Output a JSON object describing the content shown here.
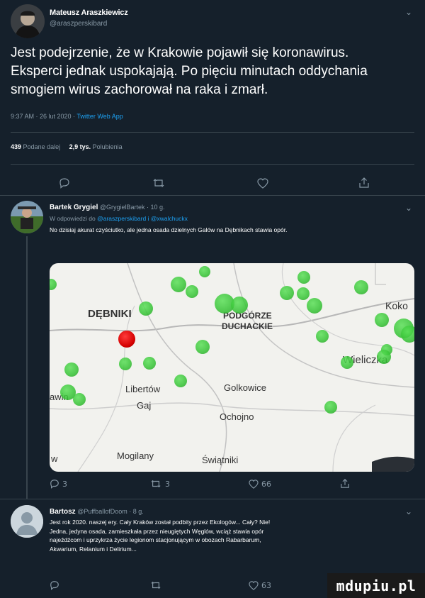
{
  "tweet": {
    "author_name": "Mateusz Araszkiewicz",
    "author_handle": "@araszperskibard",
    "text_lines": [
      "Jest podejrzenie, że w Krakowie pojawił się koronawirus.",
      "Eksperci jednak uspokajają. Po pięciu minutach oddychania",
      "smogiem wirus zachorował na raka i zmarł."
    ],
    "meta_time": "9:37 AM · 26 lut 2020 ·",
    "meta_app": "Twitter Web App",
    "retweets_count": "439",
    "retweets_label": "Podane dalej",
    "likes_count": "2,9 tys.",
    "likes_label": "Polubienia"
  },
  "reply1": {
    "author_name": "Bartek Grygiel",
    "author_meta": "@GrygielBartek · 10 g.",
    "replying_prefix": "W odpowiedzi do",
    "replying_to": "@araszperskibard i @xwalchuckx",
    "text": "No dzisiaj akurat czyściutko, ale jedna osada dzielnych Galów na Dębnikach stawia opór.",
    "map_labels": [
      "DĘBNIKI",
      "PODGÓRZE",
      "DUCHACKIE",
      "Koko",
      "Wieliczka",
      "Libertów",
      "Golkowice",
      "Gaj",
      "Ochojno",
      "w",
      "Mogilany",
      "Świątniki",
      "awin"
    ],
    "replies": "3",
    "retweets": "3",
    "likes": "66"
  },
  "reply2": {
    "author_name": "Bartosz",
    "author_meta": "@PuffballofDoom · 8 g.",
    "text_lines": [
      "Jest rok 2020. naszej ery. Cały Kraków został podbity przez Ekologów... Cały? Nie!",
      "Jedna, jedyna osada, zamieszkała przez nieugiętych Węglów, wciąż stawia opór",
      "najeźdźcom i uprzykrza życie legionom stacjonującym w obozach Rabarbarum,",
      "Akwarium, Relanium i Delirium..."
    ],
    "likes": "63"
  },
  "watermark": "mdupiu.pl",
  "colors": {
    "background": "#15202b",
    "accent": "#1da1f2",
    "muted": "#8899a6",
    "map_bg": "#f2f2ee",
    "map_dot_green": "#35c234",
    "map_dot_red": "#d40000"
  }
}
